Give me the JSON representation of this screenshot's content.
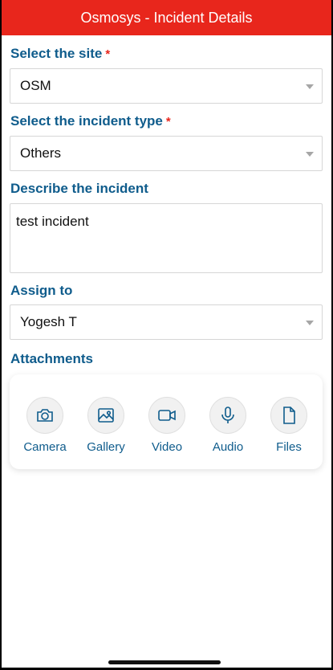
{
  "header": {
    "title": "Osmosys - Incident Details"
  },
  "site": {
    "label": "Select the site",
    "required_mark": "*",
    "value": "OSM"
  },
  "incident_type": {
    "label": "Select the incident type",
    "required_mark": "*",
    "value": "Others"
  },
  "description": {
    "label": "Describe the incident",
    "value": "test incident"
  },
  "assign": {
    "label": "Assign to",
    "value": "Yogesh T"
  },
  "attachments": {
    "label": "Attachments",
    "items": [
      {
        "label": "Camera",
        "icon": "camera-icon"
      },
      {
        "label": "Gallery",
        "icon": "image-icon"
      },
      {
        "label": "Video",
        "icon": "video-camera-icon"
      },
      {
        "label": "Audio",
        "icon": "microphone-icon"
      },
      {
        "label": "Files",
        "icon": "file-icon"
      }
    ]
  },
  "colors": {
    "header_bg": "#e8261c",
    "label": "#0f5c8c",
    "required": "#e8261c"
  }
}
